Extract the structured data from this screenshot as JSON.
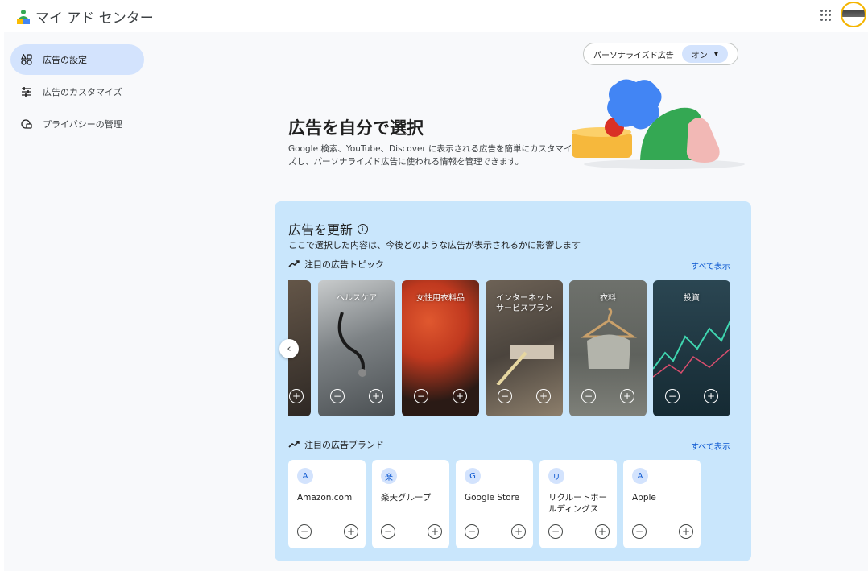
{
  "header": {
    "title": "マイ アド センター"
  },
  "sidebar": {
    "items": [
      {
        "label": "広告の設定",
        "icon": "ad-settings-icon"
      },
      {
        "label": "広告のカスタマイズ",
        "icon": "tune-icon"
      },
      {
        "label": "プライバシーの管理",
        "icon": "privacy-icon"
      }
    ]
  },
  "personalized": {
    "label": "パーソナライズド広告",
    "value": "オン"
  },
  "hero": {
    "title": "広告を自分で選択",
    "description": "Google 検索、YouTube、Discover に表示される広告を簡単にカスタマイズし、パーソナライズド広告に使われる情報を管理できます。"
  },
  "card": {
    "title": "広告を更新",
    "subtitle": "ここで選択した内容は、今後どのような広告が表示されるかに影響します"
  },
  "topics": {
    "heading": "注目の広告トピック",
    "see_all": "すべて表示",
    "items": [
      {
        "label": "",
        "color": "#5a5048"
      },
      {
        "label": "ヘルスケア",
        "color": "#8a8e90"
      },
      {
        "label": "女性用衣料品",
        "color": "#b8412a"
      },
      {
        "label": "インターネット\nサービスプラン",
        "color": "#7a6a55"
      },
      {
        "label": "衣料",
        "color": "#6b6f6a"
      },
      {
        "label": "投資",
        "color": "#1d3a45"
      }
    ]
  },
  "brands": {
    "heading": "注目の広告ブランド",
    "see_all": "すべて表示",
    "items": [
      {
        "initial": "A",
        "name": "Amazon.com"
      },
      {
        "initial": "楽",
        "name": "楽天グループ"
      },
      {
        "initial": "G",
        "name": "Google Store"
      },
      {
        "initial": "リ",
        "name": "リクルートホールディングス"
      },
      {
        "initial": "A",
        "name": "Apple"
      }
    ]
  }
}
